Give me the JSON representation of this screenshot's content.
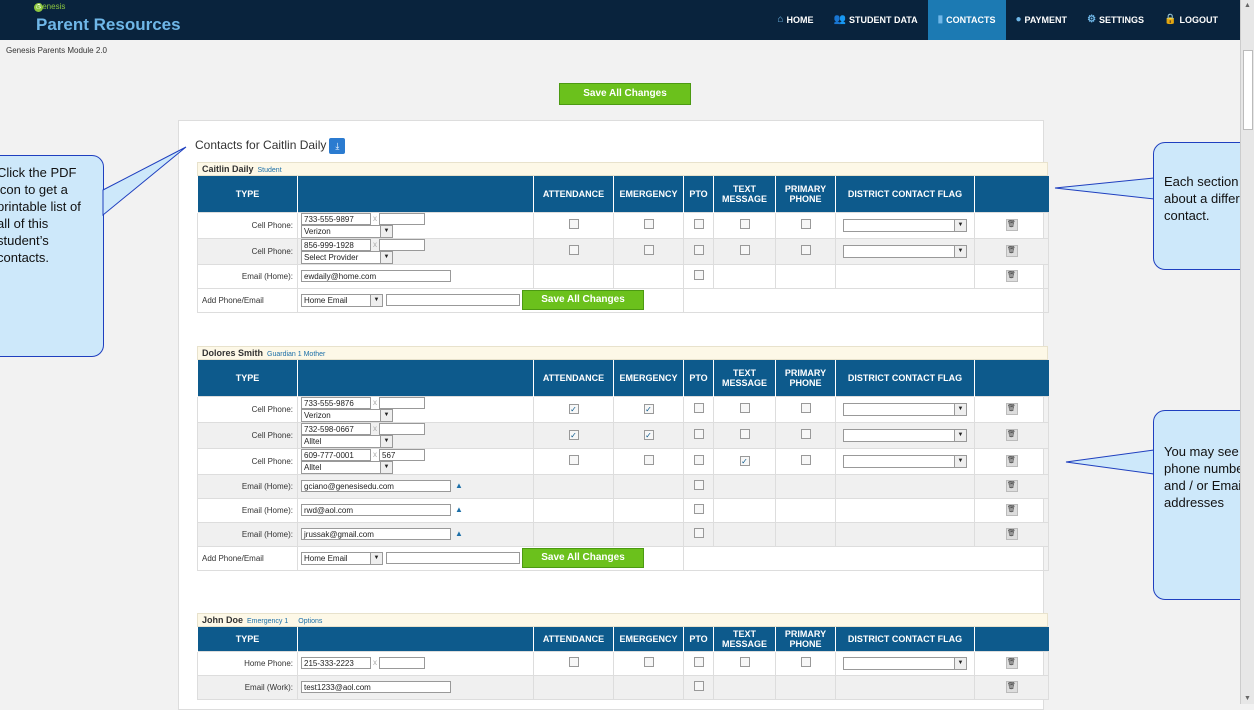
{
  "header": {
    "brand_small": "Genesis",
    "brand": "Parent Resources",
    "subtitle": "Genesis Parents Module 2.0"
  },
  "nav": [
    {
      "label": "HOME",
      "icon": "home-icon",
      "glyph": "⌂",
      "active": false
    },
    {
      "label": "STUDENT DATA",
      "icon": "people-icon",
      "glyph": "👥",
      "active": false
    },
    {
      "label": "CONTACTS",
      "icon": "contacts-icon",
      "glyph": "▮",
      "active": true
    },
    {
      "label": "PAYMENT",
      "icon": "payment-icon",
      "glyph": "●",
      "active": false
    },
    {
      "label": "SETTINGS",
      "icon": "gear-icon",
      "glyph": "⚙",
      "active": false
    },
    {
      "label": "LOGOUT",
      "icon": "lock-icon",
      "glyph": "🔒",
      "active": false
    }
  ],
  "save_all": "Save All Changes",
  "panel_title": "Contacts for Caitlin Daily",
  "columns": [
    "TYPE",
    "",
    "ATTENDANCE",
    "EMERGENCY",
    "PTO",
    "TEXT MESSAGE",
    "PRIMARY PHONE",
    "DISTRICT CONTACT FLAG",
    ""
  ],
  "add_label": "Add Phone/Email",
  "add_type": "Home Email",
  "contacts": [
    {
      "name": "Caitlin Daily",
      "role": "Student",
      "rows": [
        {
          "label": "Cell Phone:",
          "kind": "phone",
          "number": "733-555-9897",
          "ext": "",
          "provider": "Verizon",
          "att": false,
          "emg": false,
          "pto": false,
          "txt": false,
          "pri": false
        },
        {
          "label": "Cell Phone:",
          "kind": "phone",
          "number": "856-999-1928",
          "ext": "",
          "provider": "Select Provider",
          "att": false,
          "emg": false,
          "pto": false,
          "txt": false,
          "pri": false
        },
        {
          "label": "Email (Home):",
          "kind": "email",
          "value": "ewdaily@home.com",
          "pto": false
        }
      ]
    },
    {
      "name": "Dolores Smith",
      "role": "Guardian 1  Mother",
      "rows": [
        {
          "label": "Cell Phone:",
          "kind": "phone",
          "number": "733-555-9876",
          "ext": "",
          "provider": "Verizon",
          "att": true,
          "emg": true,
          "pto": false,
          "txt": false,
          "pri": false
        },
        {
          "label": "Cell Phone:",
          "kind": "phone",
          "number": "732-598-0667",
          "ext": "",
          "provider": "Alltel",
          "att": true,
          "emg": true,
          "pto": false,
          "txt": false,
          "pri": false
        },
        {
          "label": "Cell Phone:",
          "kind": "phone",
          "number": "609-777-0001",
          "ext": "567",
          "provider": "Alltel",
          "att": false,
          "emg": false,
          "pto": false,
          "txt": true,
          "pri": false
        },
        {
          "label": "Email (Home):",
          "kind": "email",
          "value": "gciano@genesisedu.com",
          "pto": false,
          "person": true
        },
        {
          "label": "Email (Home):",
          "kind": "email",
          "value": "rwd@aol.com",
          "pto": false,
          "person": true
        },
        {
          "label": "Email (Home):",
          "kind": "email",
          "value": "jrussak@gmail.com",
          "pto": false,
          "person": true
        }
      ]
    },
    {
      "name": "John Doe",
      "role": "Emergency 1",
      "options": "Options",
      "rows": [
        {
          "label": "Home Phone:",
          "kind": "phone1",
          "number": "215-333-2223",
          "ext": "",
          "att": false,
          "emg": false,
          "pto": false,
          "txt": false,
          "pri": false
        },
        {
          "label": "Email (Work):",
          "kind": "email",
          "value": "test1233@aol.com",
          "pto": false
        }
      ]
    }
  ],
  "callouts": {
    "left": "Click the PDF icon to get a printable list of all of this student’s contacts.",
    "right_top": "Each section is about a different contact.",
    "right_mid": "You may see phone numbers and / or Email addresses"
  }
}
